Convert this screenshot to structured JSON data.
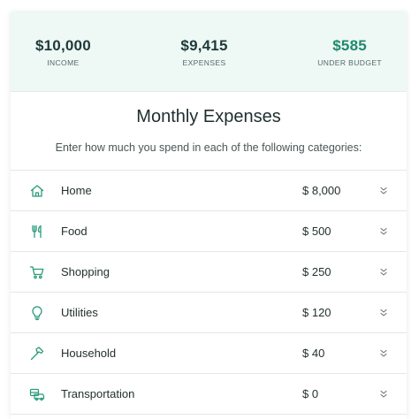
{
  "summary": {
    "income": {
      "value": "$10,000",
      "label": "INCOME"
    },
    "expenses": {
      "value": "$9,415",
      "label": "EXPENSES"
    },
    "under_budget": {
      "value": "$585",
      "label": "UNDER BUDGET"
    }
  },
  "colors": {
    "accent": "#1f8a6c",
    "summary_bg": "#eef8f5",
    "icon": "#2a9a7b"
  },
  "heading": {
    "title": "Monthly Expenses",
    "subtitle": "Enter how much you spend in each of the following categories:"
  },
  "categories": [
    {
      "name": "Home",
      "amount": "$ 8,000",
      "icon": "home-icon"
    },
    {
      "name": "Food",
      "amount": "$ 500",
      "icon": "fork-knife-icon"
    },
    {
      "name": "Shopping",
      "amount": "$ 250",
      "icon": "shopping-cart-icon"
    },
    {
      "name": "Utilities",
      "amount": "$ 120",
      "icon": "lightbulb-icon"
    },
    {
      "name": "Household",
      "amount": "$ 40",
      "icon": "hammer-icon"
    },
    {
      "name": "Transportation",
      "amount": "$ 0",
      "icon": "vehicles-icon"
    }
  ]
}
